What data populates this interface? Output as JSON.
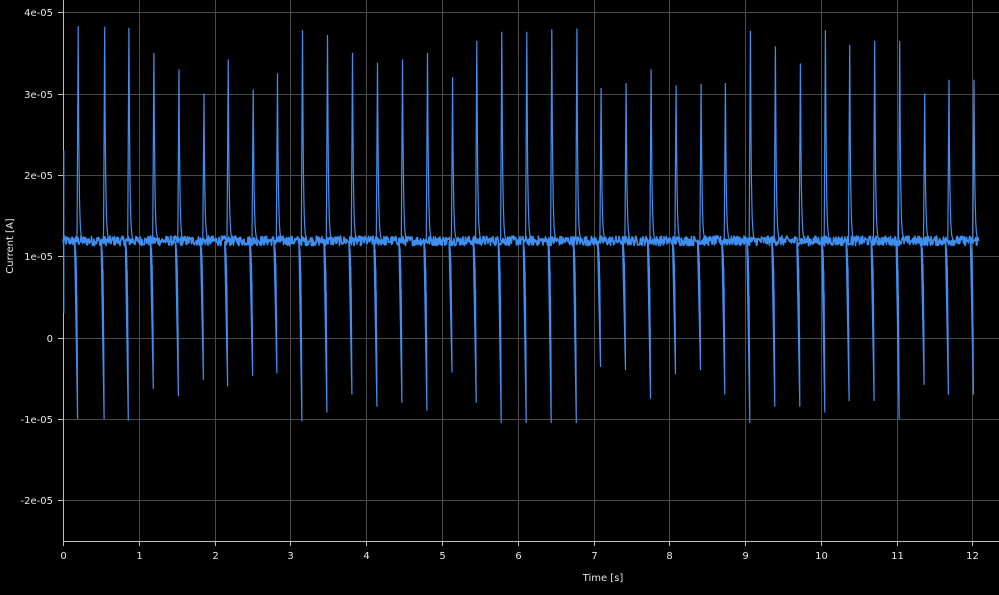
{
  "chart_data": {
    "type": "line",
    "title": "",
    "xlabel": "Time [s]",
    "ylabel": "Current [A]",
    "xlim": [
      0,
      12.35
    ],
    "ylim": [
      -2.5e-05,
      4.15e-05
    ],
    "xticks": [
      0,
      1,
      2,
      3,
      4,
      5,
      6,
      7,
      8,
      9,
      10,
      11,
      12
    ],
    "xtick_labels": [
      "0",
      "1",
      "2",
      "3",
      "4",
      "5",
      "6",
      "7",
      "8",
      "9",
      "10",
      "11",
      "12"
    ],
    "yticks": [
      -2e-05,
      -1e-05,
      0,
      1e-05,
      2e-05,
      3e-05,
      4e-05
    ],
    "ytick_labels": [
      "-2e-05",
      "-1e-05",
      "0",
      "1e-05",
      "2e-05",
      "3e-05",
      "4e-05"
    ],
    "grid": true,
    "background": "#000000",
    "grid_color": "#4a4a4a",
    "series": [
      {
        "color": "#3f8ff0",
        "baseline": 1.19e-05,
        "x_start": 0,
        "x_end": 12.08,
        "start_spike": {
          "x": 0.0,
          "max": 2.3e-05,
          "min": 3e-06
        },
        "spikes": [
          {
            "x": 0.2,
            "max": 3.83e-05,
            "min": -1e-05
          },
          {
            "x": 0.55,
            "max": 3.82e-05,
            "min": -1e-05
          },
          {
            "x": 0.87,
            "max": 3.81e-05,
            "min": -1.02e-05
          },
          {
            "x": 1.2,
            "max": 3.5e-05,
            "min": -6.3e-06
          },
          {
            "x": 1.53,
            "max": 3.3e-05,
            "min": -7.2e-06
          },
          {
            "x": 1.86,
            "max": 3e-05,
            "min": -5.2e-06
          },
          {
            "x": 2.18,
            "max": 3.42e-05,
            "min": -6e-06
          },
          {
            "x": 2.51,
            "max": 3.05e-05,
            "min": -4.7e-06
          },
          {
            "x": 2.83,
            "max": 3.25e-05,
            "min": -4.4e-06
          },
          {
            "x": 3.16,
            "max": 3.78e-05,
            "min": -1.03e-05
          },
          {
            "x": 3.49,
            "max": 3.72e-05,
            "min": -9.2e-06
          },
          {
            "x": 3.82,
            "max": 3.5e-05,
            "min": -7e-06
          },
          {
            "x": 4.15,
            "max": 3.38e-05,
            "min": -8.5e-06
          },
          {
            "x": 4.48,
            "max": 3.42e-05,
            "min": -8e-06
          },
          {
            "x": 4.81,
            "max": 3.5e-05,
            "min": -9e-06
          },
          {
            "x": 5.14,
            "max": 3.2e-05,
            "min": -4.3e-06
          },
          {
            "x": 5.46,
            "max": 3.65e-05,
            "min": -8e-06
          },
          {
            "x": 5.79,
            "max": 3.76e-05,
            "min": -1.05e-05
          },
          {
            "x": 6.12,
            "max": 3.76e-05,
            "min": -1.05e-05
          },
          {
            "x": 6.45,
            "max": 3.79e-05,
            "min": -1.05e-05
          },
          {
            "x": 6.78,
            "max": 3.8e-05,
            "min": -1.05e-05
          },
          {
            "x": 7.1,
            "max": 3.07e-05,
            "min": -3.6e-06
          },
          {
            "x": 7.43,
            "max": 3.13e-05,
            "min": -4e-06
          },
          {
            "x": 7.76,
            "max": 3.3e-05,
            "min": -7.5e-06
          },
          {
            "x": 8.09,
            "max": 3.1e-05,
            "min": -4.5e-06
          },
          {
            "x": 8.42,
            "max": 3.12e-05,
            "min": -4e-06
          },
          {
            "x": 8.74,
            "max": 3.13e-05,
            "min": -7e-06
          },
          {
            "x": 9.07,
            "max": 3.77e-05,
            "min": -1.05e-05
          },
          {
            "x": 9.4,
            "max": 3.58e-05,
            "min": -8.5e-06
          },
          {
            "x": 9.73,
            "max": 3.37e-05,
            "min": -8.5e-06
          },
          {
            "x": 10.06,
            "max": 3.78e-05,
            "min": -9.2e-06
          },
          {
            "x": 10.38,
            "max": 3.6e-05,
            "min": -7.8e-06
          },
          {
            "x": 10.71,
            "max": 3.65e-05,
            "min": -7.8e-06
          },
          {
            "x": 11.04,
            "max": 3.65e-05,
            "min": -1e-05
          },
          {
            "x": 11.37,
            "max": 3e-05,
            "min": -5.8e-06
          },
          {
            "x": 11.69,
            "max": 3.17e-05,
            "min": -7e-06
          },
          {
            "x": 12.02,
            "max": 3.17e-05,
            "min": -7e-06
          }
        ]
      }
    ]
  }
}
